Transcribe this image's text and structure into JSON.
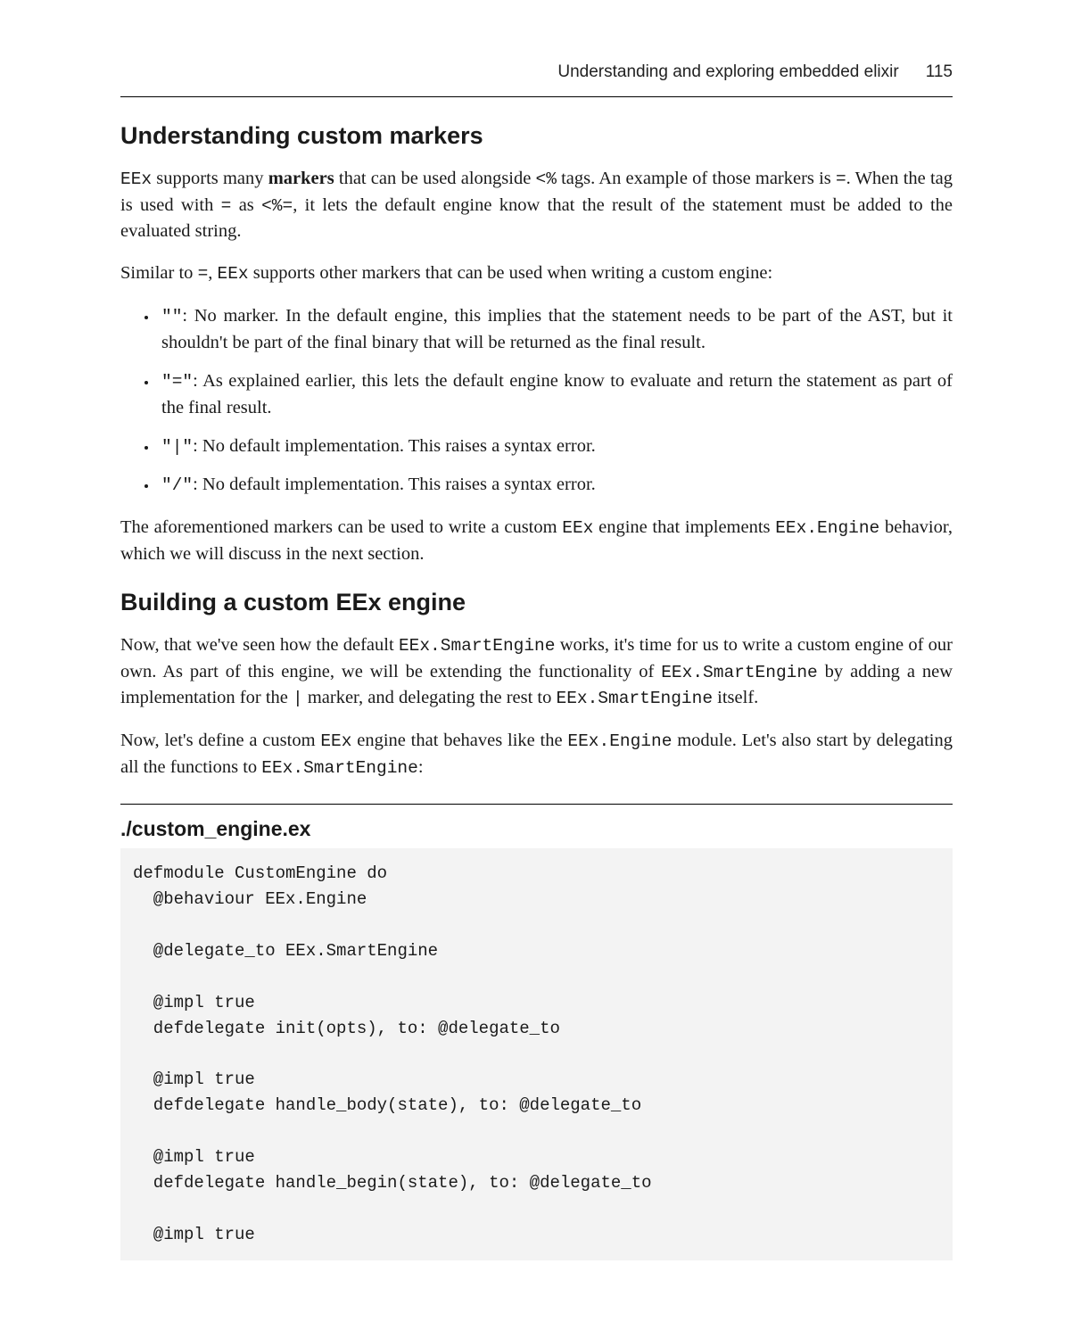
{
  "header": {
    "running_title": "Understanding and exploring embedded elixir",
    "page_number": "115"
  },
  "section1": {
    "heading": "Understanding custom markers",
    "p1_parts": [
      {
        "t": "code",
        "v": "EEx"
      },
      {
        "t": "text",
        "v": " supports many "
      },
      {
        "t": "strong",
        "v": "markers"
      },
      {
        "t": "text",
        "v": " that can be used alongside "
      },
      {
        "t": "code",
        "v": "<%"
      },
      {
        "t": "text",
        "v": " tags. An example of those markers is "
      },
      {
        "t": "code",
        "v": "="
      },
      {
        "t": "text",
        "v": ". When the tag is used with "
      },
      {
        "t": "code",
        "v": "="
      },
      {
        "t": "text",
        "v": " as "
      },
      {
        "t": "code",
        "v": "<%="
      },
      {
        "t": "text",
        "v": ", it lets the default engine know that the result of the statement must be added to the evaluated string."
      }
    ],
    "p2_parts": [
      {
        "t": "text",
        "v": "Similar to "
      },
      {
        "t": "code",
        "v": "="
      },
      {
        "t": "text",
        "v": ", "
      },
      {
        "t": "code",
        "v": "EEx"
      },
      {
        "t": "text",
        "v": " supports other markers that can be used when writing a custom engine:"
      }
    ],
    "bullets": [
      [
        {
          "t": "code",
          "v": "\"\""
        },
        {
          "t": "text",
          "v": ": No marker. In the default engine, this implies that the statement needs to be part of the AST, but it shouldn't be part of the final binary that will be returned as the final result."
        }
      ],
      [
        {
          "t": "code",
          "v": "\"=\""
        },
        {
          "t": "text",
          "v": ": As explained earlier, this lets the default engine know to evaluate and return the statement as part of the final result."
        }
      ],
      [
        {
          "t": "code",
          "v": "\"|\""
        },
        {
          "t": "text",
          "v": ": No default implementation. This raises a syntax error."
        }
      ],
      [
        {
          "t": "code",
          "v": "\"/\""
        },
        {
          "t": "text",
          "v": ": No default implementation. This raises a syntax error."
        }
      ]
    ],
    "p3_parts": [
      {
        "t": "text",
        "v": "The aforementioned markers can be used to write a custom "
      },
      {
        "t": "code",
        "v": "EEx"
      },
      {
        "t": "text",
        "v": " engine that implements "
      },
      {
        "t": "code",
        "v": "EEx.Engine"
      },
      {
        "t": "text",
        "v": " behavior, which we will discuss in the next section."
      }
    ]
  },
  "section2": {
    "heading": "Building a custom EEx engine",
    "p1_parts": [
      {
        "t": "text",
        "v": "Now, that we've seen how the default "
      },
      {
        "t": "code",
        "v": "EEx.SmartEngine"
      },
      {
        "t": "text",
        "v": " works, it's time for us to write a custom engine of our own. As part of this engine, we will be extending the functionality of "
      },
      {
        "t": "code",
        "v": "EEx.SmartEngine"
      },
      {
        "t": "text",
        "v": " by adding a new implementation for the "
      },
      {
        "t": "code",
        "v": "|"
      },
      {
        "t": "text",
        "v": " marker, and delegating the rest to "
      },
      {
        "t": "code",
        "v": "EEx.SmartEngine"
      },
      {
        "t": "text",
        "v": " itself."
      }
    ],
    "p2_parts": [
      {
        "t": "text",
        "v": "Now, let's define a custom "
      },
      {
        "t": "code",
        "v": "EEx"
      },
      {
        "t": "text",
        "v": " engine that behaves like the "
      },
      {
        "t": "code",
        "v": "EEx.Engine"
      },
      {
        "t": "text",
        "v": " module. Let's also start by delegating all the functions to "
      },
      {
        "t": "code",
        "v": "EEx.SmartEngine"
      },
      {
        "t": "text",
        "v": ":"
      }
    ],
    "code_filename": "./custom_engine.ex",
    "code_lines": [
      "defmodule CustomEngine do",
      "  @behaviour EEx.Engine",
      "",
      "  @delegate_to EEx.SmartEngine",
      "",
      "  @impl true",
      "  defdelegate init(opts), to: @delegate_to",
      "",
      "  @impl true",
      "  defdelegate handle_body(state), to: @delegate_to",
      "",
      "  @impl true",
      "  defdelegate handle_begin(state), to: @delegate_to",
      "",
      "  @impl true"
    ]
  }
}
